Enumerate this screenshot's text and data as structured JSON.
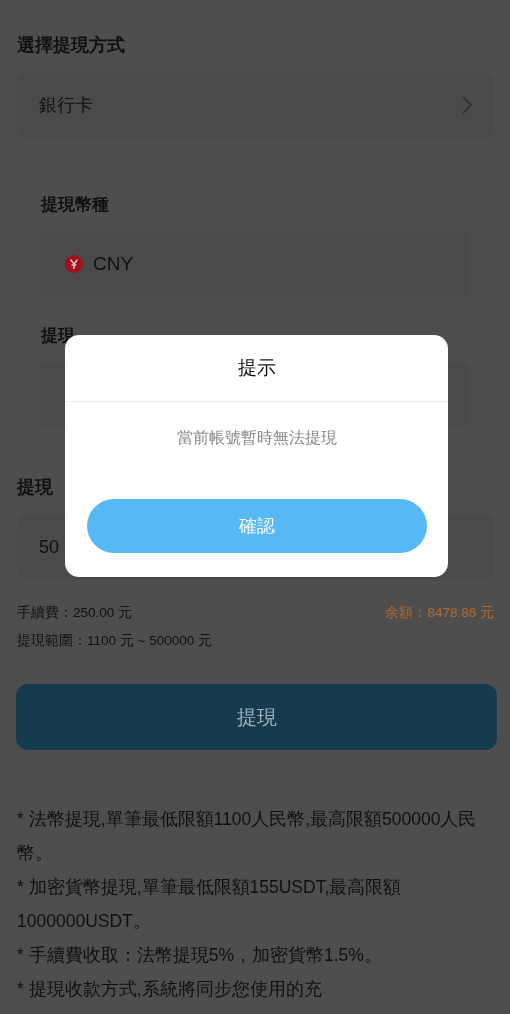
{
  "form": {
    "method_label": "選擇提現方式",
    "method_value": "銀行卡",
    "currency_label": "提現幣種",
    "currency_value": "CNY",
    "bank_label": "提現",
    "amount_label": "提現",
    "amount_value": "50",
    "fee": "手續費：250.00 元",
    "balance": "余額：8478.86 元",
    "range": "提現範圍：1100 元 ~ 500000 元",
    "submit": "提現"
  },
  "notes": [
    "* 法幣提現,單筆最低限額1100人民幣,最高限額500000人民幣。",
    "* 加密貨幣提現,單筆最低限額155USDT,最高限額1000000USDT。",
    "* 手續費收取：法幣提現5%，加密貨幣1.5%。",
    "* 提現收款方式,系統將同步您使用的充"
  ],
  "dialog": {
    "title": "提示",
    "message": "當前帳號暫時無法提現",
    "button": "確認"
  }
}
